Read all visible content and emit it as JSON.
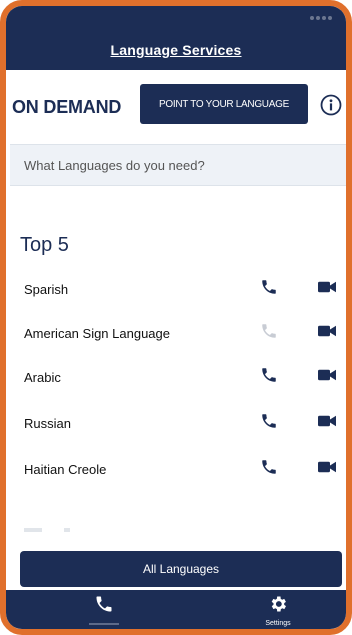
{
  "header": {
    "title": "Language Services"
  },
  "on_demand": {
    "label": "ON DEMAND",
    "point_button": "POINT TO YOUR LANGUAGE"
  },
  "search": {
    "placeholder": "What Languages do you need?"
  },
  "top5": {
    "title": "Top 5",
    "items": [
      {
        "label": "Sparish",
        "phone_enabled": true
      },
      {
        "label": "American Sign Language",
        "phone_enabled": false
      },
      {
        "label": "Arabic",
        "phone_enabled": true
      },
      {
        "label": "Russian",
        "phone_enabled": true
      },
      {
        "label": "Haitian Creole",
        "phone_enabled": true
      }
    ]
  },
  "all_button": {
    "label": "All Languages"
  },
  "tabbar": {
    "settings_label": "Settings"
  },
  "colors": {
    "navy": "#1c2d55",
    "border": "#e0702c",
    "disabled": "#c8ccd4"
  }
}
